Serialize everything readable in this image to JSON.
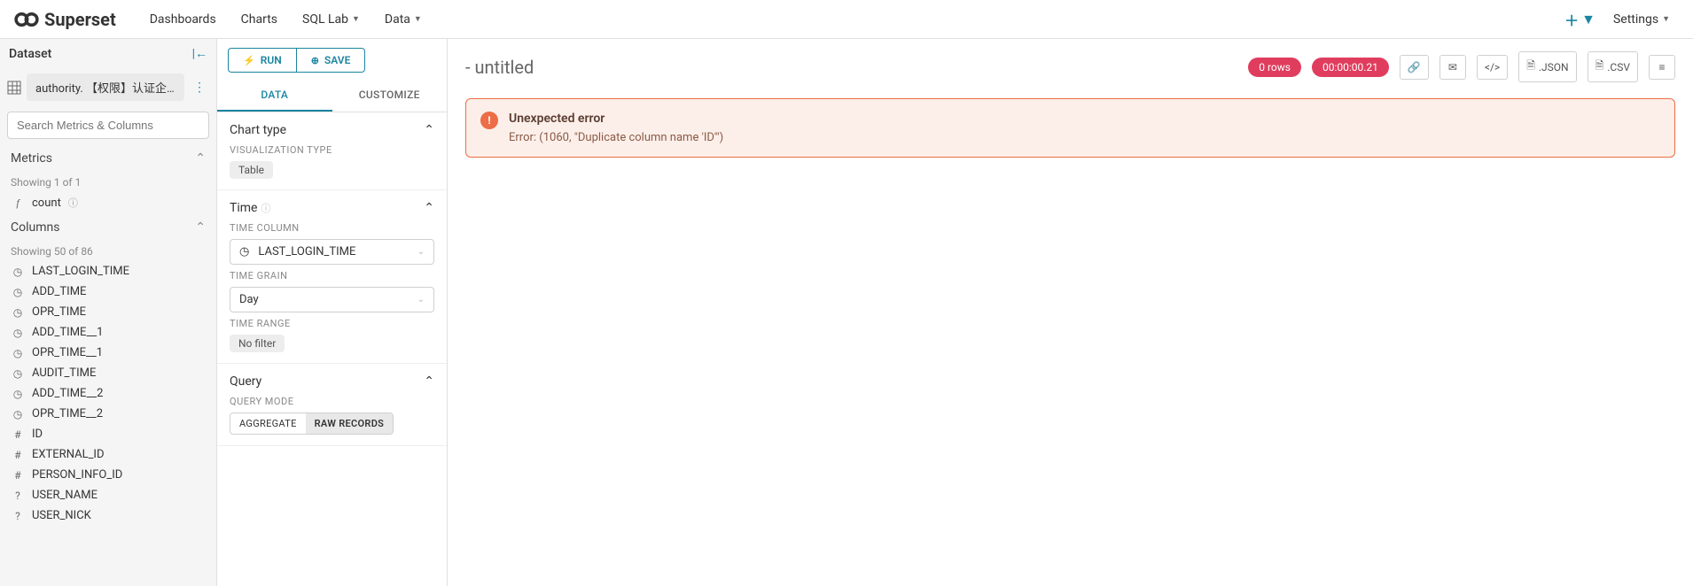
{
  "brand": "Superset",
  "nav": {
    "dashboards": "Dashboards",
    "charts": "Charts",
    "sql_lab": "SQL Lab",
    "data": "Data",
    "settings": "Settings"
  },
  "dataset_panel": {
    "title": "Dataset",
    "selected": "authority. 【权限】认证企业数",
    "search_placeholder": "Search Metrics & Columns",
    "metrics_title": "Metrics",
    "metrics_hint": "Showing 1 of 1",
    "metric_count": "count",
    "columns_title": "Columns",
    "columns_hint": "Showing 50 of 86",
    "columns": [
      {
        "ic": "clock",
        "name": "LAST_LOGIN_TIME"
      },
      {
        "ic": "clock",
        "name": "ADD_TIME"
      },
      {
        "ic": "clock",
        "name": "OPR_TIME"
      },
      {
        "ic": "clock",
        "name": "ADD_TIME__1"
      },
      {
        "ic": "clock",
        "name": "OPR_TIME__1"
      },
      {
        "ic": "clock",
        "name": "AUDIT_TIME"
      },
      {
        "ic": "clock",
        "name": "ADD_TIME__2"
      },
      {
        "ic": "clock",
        "name": "OPR_TIME__2"
      },
      {
        "ic": "hash",
        "name": "ID"
      },
      {
        "ic": "hash",
        "name": "EXTERNAL_ID"
      },
      {
        "ic": "hash",
        "name": "PERSON_INFO_ID"
      },
      {
        "ic": "q",
        "name": "USER_NAME"
      },
      {
        "ic": "q",
        "name": "USER_NICK"
      }
    ]
  },
  "control_panel": {
    "run": "RUN",
    "save": "SAVE",
    "tab_data": "DATA",
    "tab_customize": "CUSTOMIZE",
    "chart_type_title": "Chart type",
    "viz_type_label": "VISUALIZATION TYPE",
    "viz_type": "Table",
    "time_title": "Time",
    "time_col_label": "TIME COLUMN",
    "time_col": "LAST_LOGIN_TIME",
    "time_grain_label": "TIME GRAIN",
    "time_grain": "Day",
    "time_range_label": "TIME RANGE",
    "time_range": "No filter",
    "query_title": "Query",
    "query_mode_label": "QUERY MODE",
    "agg": "AGGREGATE",
    "raw": "RAW RECORDS"
  },
  "chart": {
    "title": "- untitled",
    "rows_badge": "0 rows",
    "time_badge": "00:00:00.21",
    "json": ".JSON",
    "csv": ".CSV",
    "error_title": "Unexpected error",
    "error_msg": "Error: (1060, \"Duplicate column name 'ID'\")"
  }
}
